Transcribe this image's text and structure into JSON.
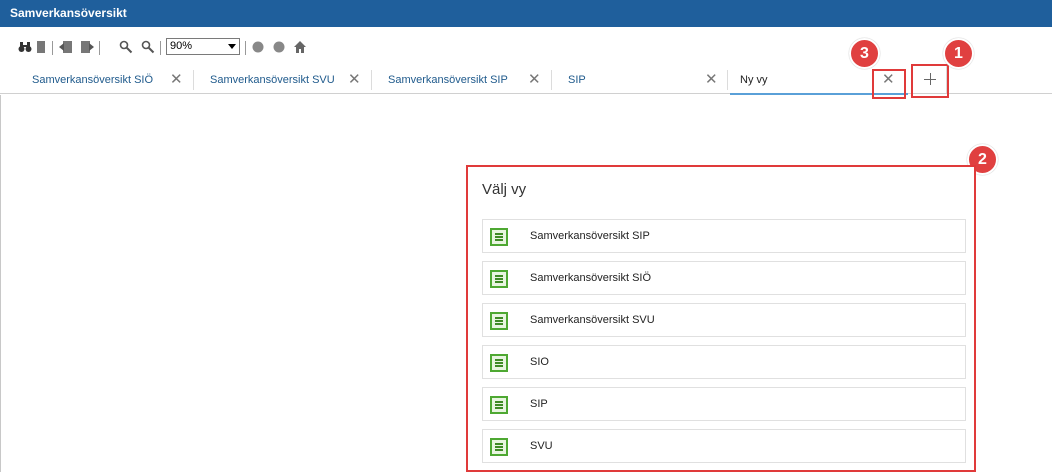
{
  "window": {
    "title": "Samverkansöversikt"
  },
  "toolbar": {
    "zoom": "90%",
    "icons": [
      "binoculars-icon",
      "page-icon",
      "prev-page-icon",
      "next-page-icon",
      "zoom-out-icon",
      "zoom-in-icon",
      "circle-icon",
      "circle-icon",
      "home-icon"
    ]
  },
  "tabs": [
    {
      "label": "Samverkansöversikt SIÖ",
      "close": "✕"
    },
    {
      "label": "Samverkansöversikt SVU",
      "close": "✕"
    },
    {
      "label": "Samverkansöversikt SIP",
      "close": "✕"
    },
    {
      "label": "SIP",
      "close": "✕"
    },
    {
      "label": "Ny vy",
      "close": "✕"
    }
  ],
  "callouts": [
    "1",
    "2",
    "3"
  ],
  "view_picker": {
    "title": "Välj vy",
    "items": [
      {
        "label": "Samverkansöversikt SIP"
      },
      {
        "label": "Samverkansöversikt SIÖ"
      },
      {
        "label": "Samverkansöversikt SVU"
      },
      {
        "label": "SIO"
      },
      {
        "label": "SIP"
      },
      {
        "label": "SVU"
      }
    ]
  },
  "colors": {
    "titlebar": "#1f5f9c",
    "callout": "#e04040",
    "icon_green": "#4ea832",
    "tab_text": "#1f5a8c"
  }
}
